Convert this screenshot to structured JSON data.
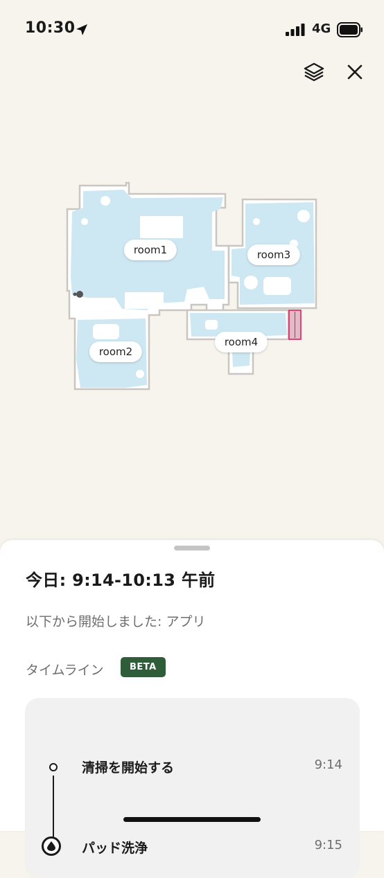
{
  "status_bar": {
    "time": "10:30",
    "network": "4G",
    "icons": [
      "location-arrow-icon",
      "signal-icon",
      "battery-icon"
    ]
  },
  "toolbar": {
    "icons": [
      "layers-icon",
      "close-icon"
    ]
  },
  "map": {
    "rooms": [
      {
        "label": "room1"
      },
      {
        "label": "room2"
      },
      {
        "label": "room3"
      },
      {
        "label": "room4"
      }
    ],
    "colors": {
      "cleaned_area": "#cde8f2",
      "wall": "#c9c6c2",
      "floor": "#ffffff",
      "no_go_zone": "#d9225b"
    }
  },
  "sheet": {
    "title": "今日: 9:14-10:13 午前",
    "started_from": "以下から開始しました: アプリ",
    "timeline_heading": "タイムライン",
    "beta_badge": "BETA",
    "events": [
      {
        "label": "清掃を開始する",
        "time": "9:14",
        "icon": "start-dot-icon"
      },
      {
        "label": "パッド洗浄",
        "time": "9:15",
        "icon": "water-drop-icon"
      }
    ]
  },
  "colors": {
    "background": "#f7f3ed",
    "beta_badge": "#2f5d3a",
    "card": "#f1f1f1"
  }
}
